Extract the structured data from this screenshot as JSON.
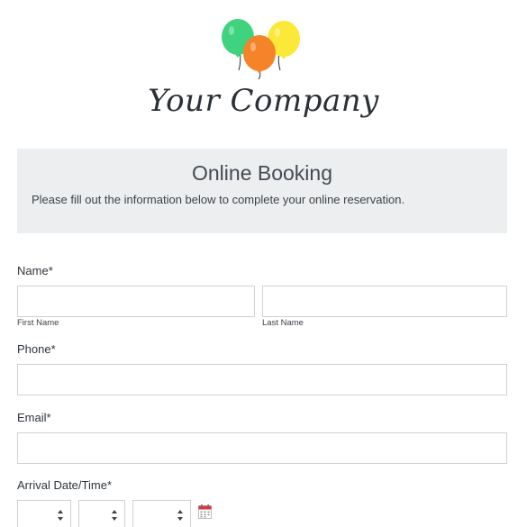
{
  "brand": {
    "company_name": "Your Company",
    "balloon_colors": [
      "#3fd37e",
      "#fbe93a",
      "#f5832a"
    ],
    "logo_icon": "balloons-icon"
  },
  "header": {
    "title": "Online Booking",
    "description": "Please fill out the information below to complete your online reservation."
  },
  "fields": {
    "name": {
      "label": "Name",
      "required_mark": "*",
      "first_sublabel": "First Name",
      "last_sublabel": "Last Name"
    },
    "phone": {
      "label": "Phone",
      "required_mark": "*"
    },
    "email": {
      "label": "Email",
      "required_mark": "*"
    },
    "arrival": {
      "label": "Arrival Date/Time",
      "required_mark": "*",
      "calendar_icon": "calendar-icon"
    }
  },
  "colors": {
    "header_bg": "#eceeef",
    "border": "#cfd3d6",
    "text": "#2f353b"
  }
}
